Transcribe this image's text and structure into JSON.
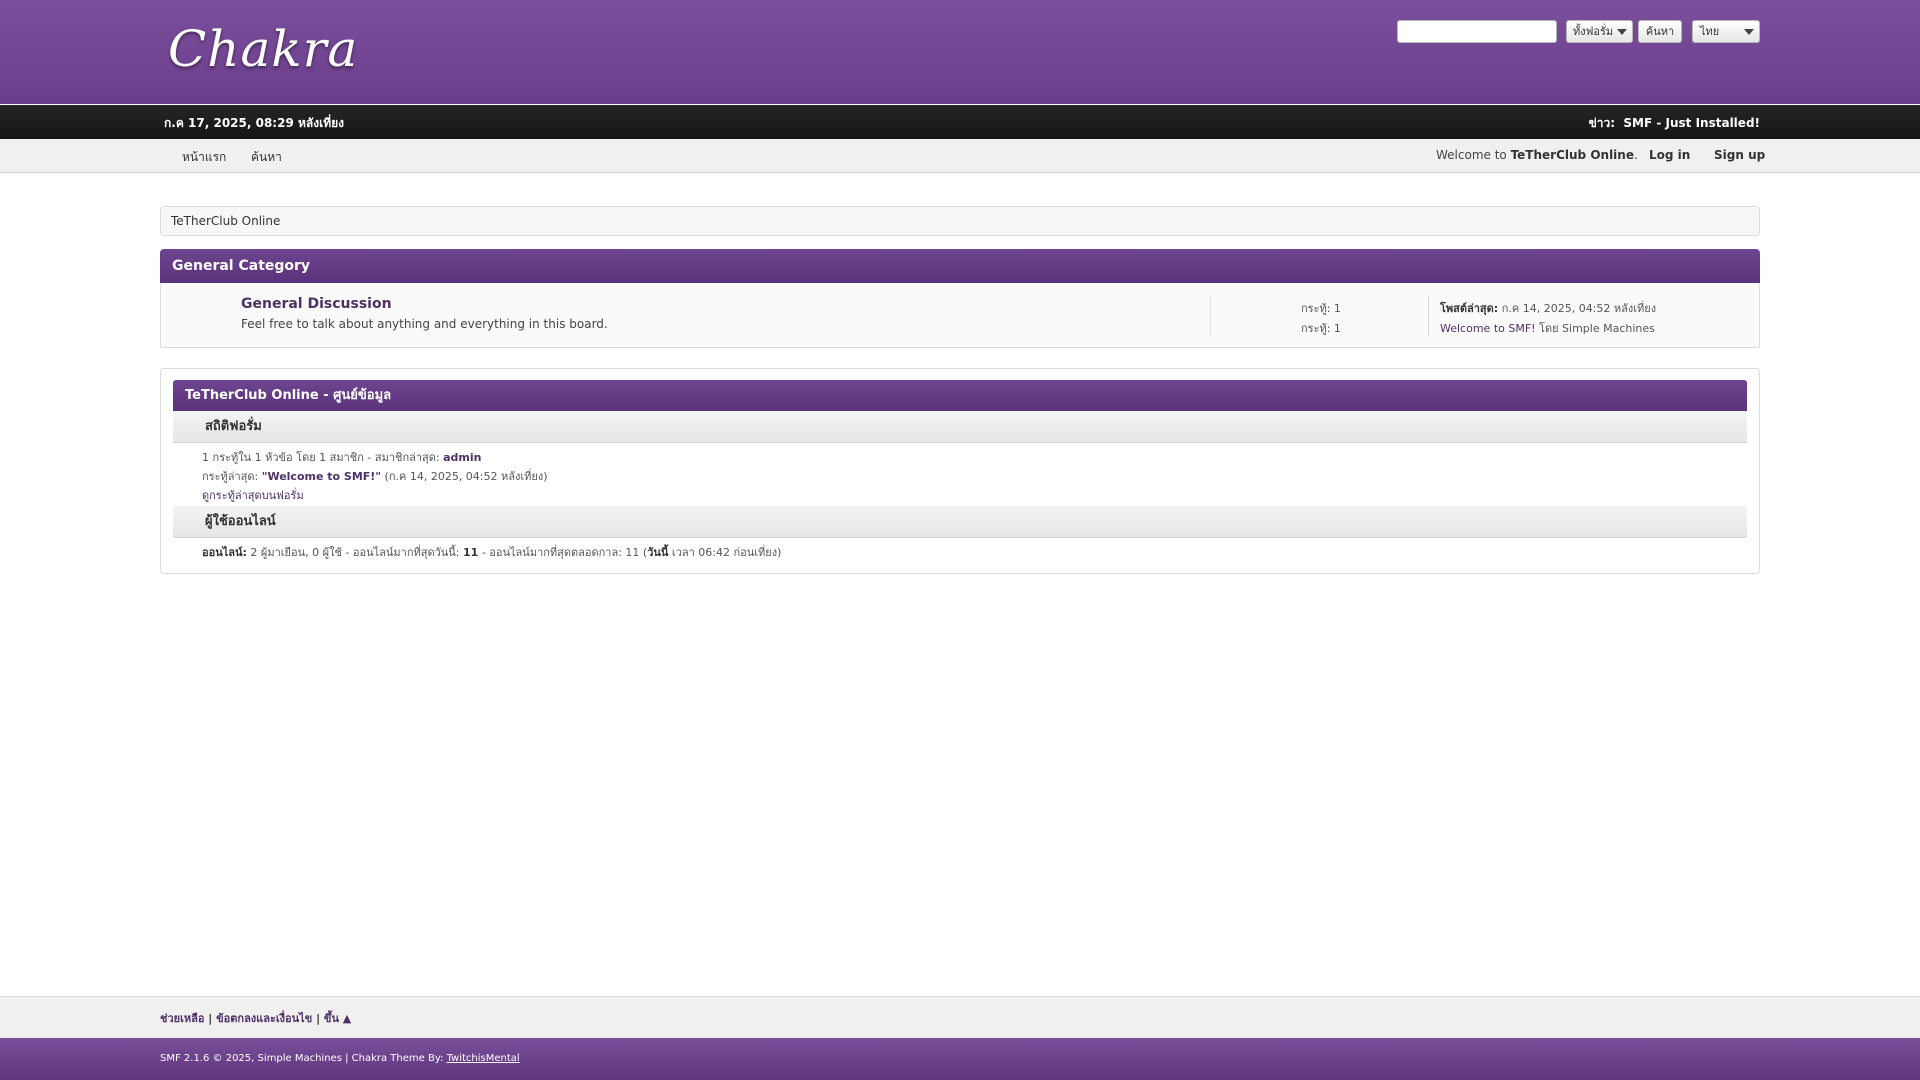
{
  "header": {
    "logo": "Chakra",
    "search_placeholder": "",
    "search_scope": "ทั้งฟอรั่ม",
    "search_button": "ค้นหา",
    "language": "ไทย"
  },
  "news_bar": {
    "date": "ก.ค 17, 2025, 08:29 หลังเที่ยง",
    "news_label": "ข่าว:",
    "news_text": "SMF - Just Installed!"
  },
  "menu": {
    "home": "หน้าแรก",
    "search": "ค้นหา",
    "welcome_prefix": "Welcome to ",
    "site_name": "TeTherClub Online",
    "welcome_suffix": ".",
    "login": "Log in",
    "signup": "Sign up"
  },
  "breadcrumb": "TeTherClub Online",
  "category": {
    "title": "General Category",
    "board": {
      "name": "General Discussion",
      "description": "Feel free to talk about anything and everything in this board.",
      "stat_posts": "กระทู้: 1",
      "stat_topics": "กระทู้: 1",
      "last_post_label": "โพสต์ล่าสุด:",
      "last_post_date": " ก.ค 14, 2025, 04:52 หลังเที่ยง",
      "last_post_topic": "Welcome to SMF!",
      "last_post_by": " โดย Simple Machines"
    }
  },
  "info_center": {
    "title": "TeTherClub Online - ศูนย์ข้อมูล",
    "forum_stats_title": "สถิติฟอรั่ม",
    "stats_line": "1 กระทู้ใน 1 หัวข้อ โดย 1 สมาชิก - สมาชิกล่าสุด: ",
    "latest_member": "admin",
    "latest_post_label": "กระทู้ล่าสุด: ",
    "latest_post_title": "\"Welcome to SMF!\"",
    "latest_post_date": " (ก.ค 14, 2025, 04:52 หลังเที่ยง)",
    "recent_posts_link": "ดูกระทู้ล่าสุดบนฟอรั่ม",
    "online_title": "ผู้ใช้ออนไลน์",
    "online_label": "ออนไลน์:",
    "online_text": " 2 ผู้มาเยือน, 0 ผู้ใช้  - ออนไลน์มากที่สุดวันนี้: ",
    "most_today": "11",
    "most_ever_text": " -  ออนไลน์มากที่สุดตลอดกาล: 11 (",
    "today_word": "วันนี้",
    "most_ever_time": " เวลา 06:42 ก่อนเที่ยง)"
  },
  "footer": {
    "help": "ช่วยเหลือ",
    "terms": "ข้อตกลงและเงื่อนไข",
    "up": "ขึ้น ▲",
    "separator": " | ",
    "copyright": "SMF 2.1.6 © 2025, Simple Machines | Chakra Theme By: ",
    "theme_author": "TwitchisMental"
  },
  "colors": {
    "header_purple": "#7a4f9b",
    "category_purple": "#5a327a",
    "link_purple": "#4e3266"
  }
}
